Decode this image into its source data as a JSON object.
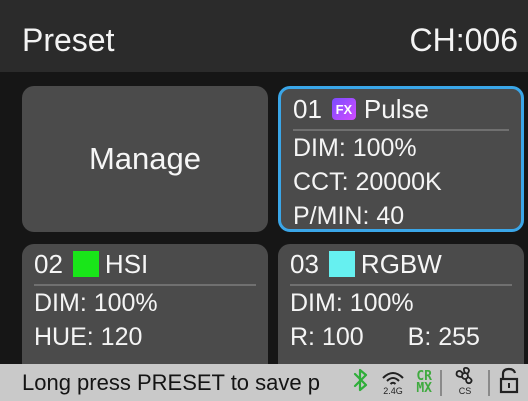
{
  "header": {
    "title": "Preset",
    "channel": "CH:006"
  },
  "manage_label": "Manage",
  "presets": [
    {
      "number": "01",
      "name": "Pulse",
      "badge": "FX",
      "icon": "fx-badge-icon",
      "selected": true,
      "lines": [
        "DIM: 100%",
        "CCT: 20000K",
        "P/MIN: 40"
      ]
    },
    {
      "number": "02",
      "name": "HSI",
      "swatch_color": "#19e619",
      "lines": [
        "DIM: 100%",
        "HUE: 120"
      ]
    },
    {
      "number": "03",
      "name": "RGBW",
      "swatch_color": "#66f0f0",
      "lines": [
        "DIM: 100%"
      ],
      "r_label": "R: 100",
      "b_label": "B: 255"
    }
  ],
  "status": {
    "message": "Long press PRESET to save p",
    "icons": [
      "bluetooth-icon",
      "wireless-2.4g-icon",
      "crmx-icon",
      "cs-fan-icon",
      "lock-icon"
    ],
    "wireless_label": "2.4G",
    "crmx_top": "CR",
    "crmx_bottom": "MX",
    "fan_label": "CS"
  },
  "colors": {
    "accent_border": "#3aa6e8",
    "bluetooth": "#2fae3a",
    "crmx": "#3faa3f"
  }
}
